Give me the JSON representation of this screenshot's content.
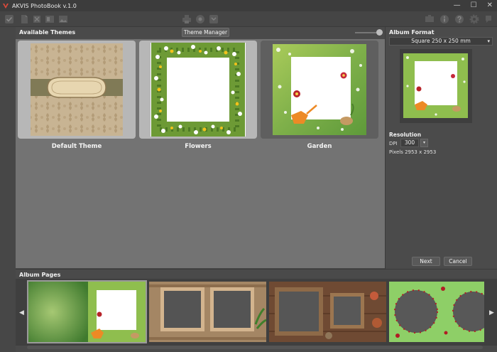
{
  "window": {
    "title": "AKVIS PhotoBook v.1.0",
    "controls": [
      "—",
      "☐",
      "✕"
    ]
  },
  "themes": {
    "section_label": "Available Themes",
    "manager_button": "Theme Manager",
    "items": [
      {
        "label": "Default Theme",
        "selected": true
      },
      {
        "label": "Flowers",
        "selected": true
      },
      {
        "label": "Garden",
        "selected": false
      }
    ]
  },
  "album_format": {
    "label": "Album Format",
    "selected": "Square 250 x 250 mm"
  },
  "resolution": {
    "label": "Resolution",
    "dpi_label": "DPI",
    "dpi_value": "300",
    "pixels_text": "Pixels 2953 x 2953"
  },
  "buttons": {
    "next": "Next",
    "cancel": "Cancel"
  },
  "album_pages": {
    "label": "Album Pages"
  },
  "colors": {
    "background": "#4a4a4a",
    "themes_area": "#737373",
    "selected_card": "#b7b7b7"
  }
}
